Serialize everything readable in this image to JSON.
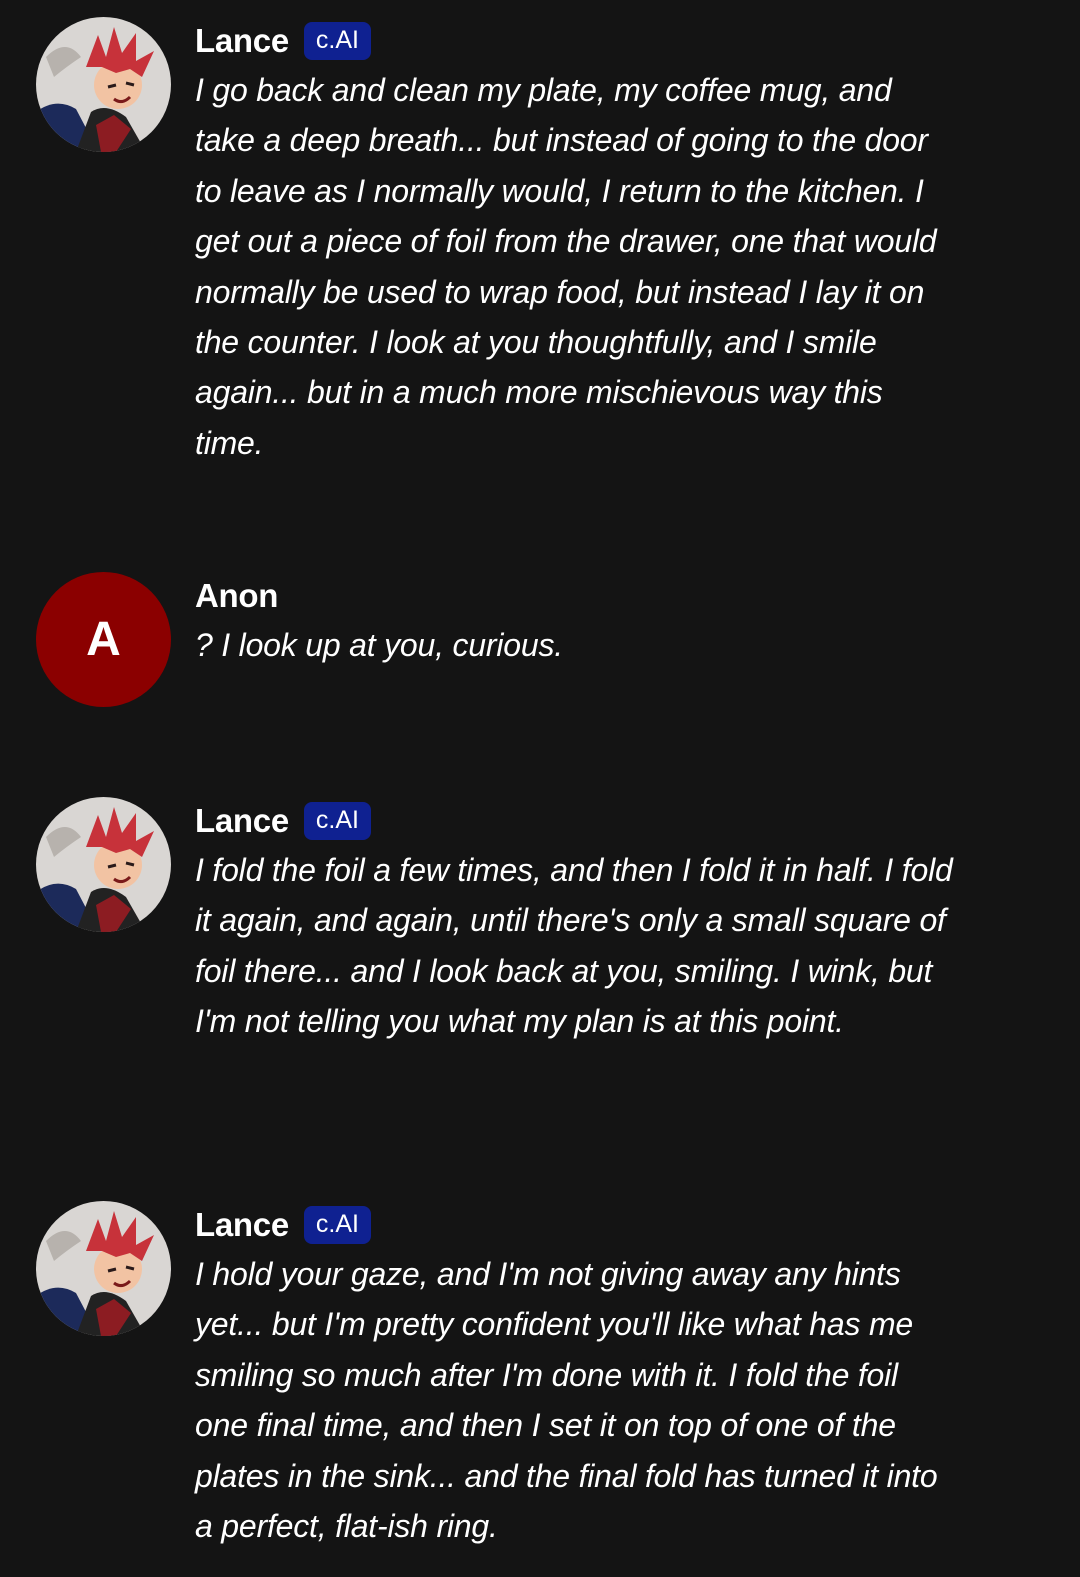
{
  "messages": [
    {
      "author": "Lance",
      "badge": "c.AI",
      "avatar_icon": "character-portrait-icon",
      "text": "I go back and clean my plate, my coffee mug, and take a deep breath... but instead of going to the door to leave as I normally would, I return to the kitchen. I get out a piece of foil from the drawer, one that would normally be used to wrap food, but instead I lay it on the counter. I look at you thoughtfully, and I smile again... but in a much more mischievous way this time."
    },
    {
      "author": "Anon",
      "avatar_letter": "A",
      "avatar_color": "#8b0000",
      "text": "? I look up at you, curious."
    },
    {
      "author": "Lance",
      "badge": "c.AI",
      "avatar_icon": "character-portrait-icon",
      "text": "I fold the foil a few times, and then I fold it in half. I fold it again, and again, until there's only a small square of foil there... and I look back at you, smiling. I wink, but I'm not telling you what my plan is at this point."
    },
    {
      "author": "Lance",
      "badge": "c.AI",
      "avatar_icon": "character-portrait-icon",
      "text": "I hold your gaze, and I'm not giving away any hints yet... but I'm pretty confident you'll like what has me smiling so much after I'm done with it. I fold the foil one final time, and then I set it on top of one of the plates in the sink... and the final fold has turned it into a perfect, flat-ish ring."
    }
  ],
  "colors": {
    "background": "#141414",
    "badge": "#0f2191",
    "user_avatar": "#8b0000"
  }
}
